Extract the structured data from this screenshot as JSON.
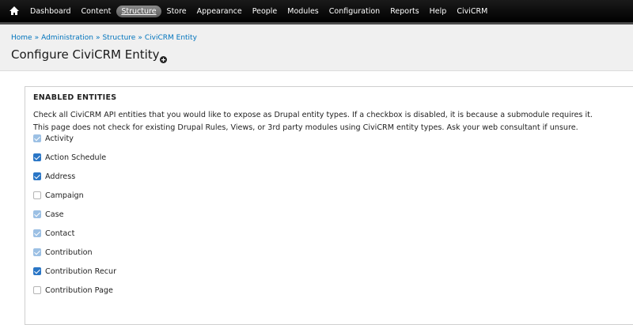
{
  "toolbar": {
    "home_icon": "home-icon",
    "items": [
      "Dashboard",
      "Content",
      "Structure",
      "Store",
      "Appearance",
      "People",
      "Modules",
      "Configuration",
      "Reports",
      "Help",
      "CiviCRM"
    ],
    "active": "Structure"
  },
  "breadcrumb": [
    "Home",
    "Administration",
    "Structure",
    "CiviCRM Entity"
  ],
  "breadcrumb_separator": "»",
  "page_title": "Configure CiviCRM Entity",
  "shortcut_icon": "add-shortcut-icon",
  "fieldset": {
    "legend": "ENABLED ENTITIES",
    "description_line1": "Check all CiviCRM API entities that you would like to expose as Drupal entity types. If a checkbox is disabled, it is because a submodule requires it.",
    "description_line2": "This page does not check for existing Drupal Rules, Views, or 3rd party modules using CiviCRM entity types. Ask your web consultant if unsure."
  },
  "entities": [
    {
      "label": "Activity",
      "checked": true,
      "disabled": true
    },
    {
      "label": "Action Schedule",
      "checked": true,
      "disabled": false
    },
    {
      "label": "Address",
      "checked": true,
      "disabled": false
    },
    {
      "label": "Campaign",
      "checked": false,
      "disabled": false
    },
    {
      "label": "Case",
      "checked": true,
      "disabled": true
    },
    {
      "label": "Contact",
      "checked": true,
      "disabled": true
    },
    {
      "label": "Contribution",
      "checked": true,
      "disabled": true
    },
    {
      "label": "Contribution Recur",
      "checked": true,
      "disabled": false
    },
    {
      "label": "Contribution Page",
      "checked": false,
      "disabled": false
    }
  ],
  "colors": {
    "toolbar_bg": "#000000",
    "link": "#0074bd",
    "checkbox_checked": "#2a76c6",
    "checkbox_disabled": "#9cc0e4"
  }
}
